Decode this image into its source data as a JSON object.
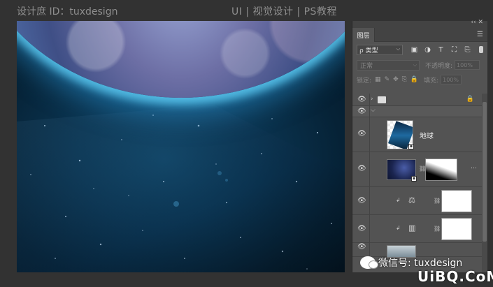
{
  "header": {
    "left_text": "设计庶 ID：tuxdesign",
    "center_text": "UI | 视觉设计 | PS教程"
  },
  "panel": {
    "collapse_glyph": "‹‹ ✕",
    "tab_label": "图层",
    "menu_glyph": "☰",
    "filter": {
      "value": "ρ 类型",
      "chevron": "⌵"
    },
    "filter_icons": [
      "▣",
      "◑",
      "T",
      "⛶",
      "⎘"
    ],
    "blend": {
      "value": "正常",
      "chevron": "⌵"
    },
    "opacity_label": "不透明度:",
    "opacity_value": "100%",
    "lock_label": "锁定:",
    "lock_icons": [
      "▦",
      "✎",
      "✥",
      "⎘",
      "🔒"
    ],
    "fill_label": "填充:",
    "fill_value": "100%"
  },
  "layers": {
    "eye_glyph": "👁",
    "group_toggle": "›",
    "group_open_toggle": "⌵",
    "lock_glyph": "🔒",
    "smart_glyph": "▪",
    "chain_glyph": "⛓",
    "clip_glyph": "↲",
    "earth_name": "地球",
    "more_glyph": "…",
    "balance_icon": "⚖",
    "levels_icon": "▥"
  },
  "watermark": {
    "text": "微信号: tuxdesign",
    "logo": "UiBQ.CoM"
  },
  "colors": {
    "ui_bg": "#323232",
    "panel_bg": "#535353",
    "space_blue": "#0b3653",
    "atmosphere_glow": "#5ac8f0"
  }
}
